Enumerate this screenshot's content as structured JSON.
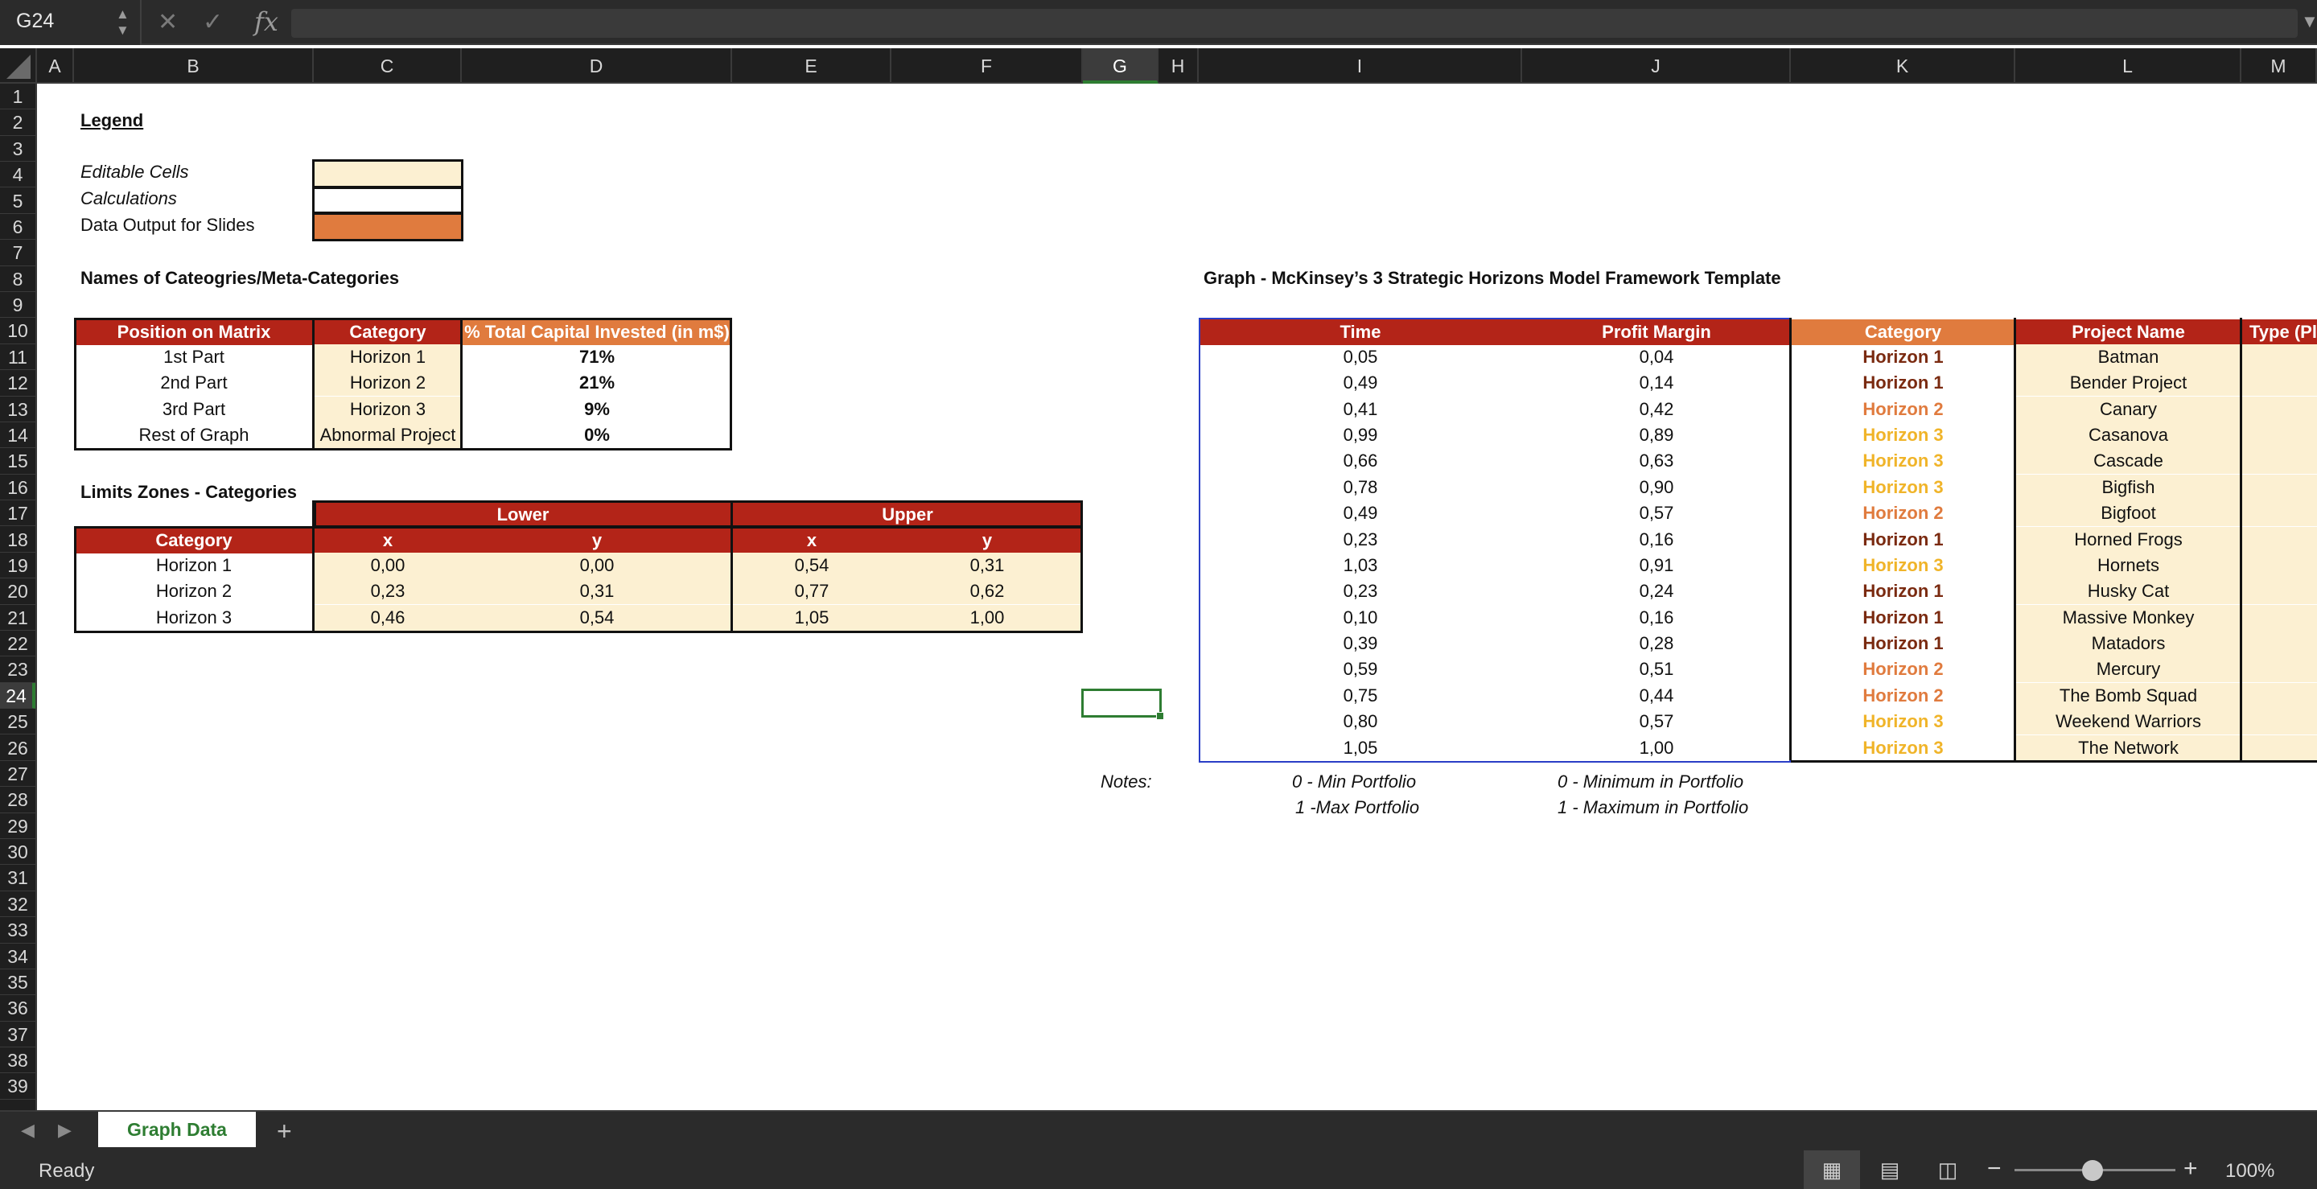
{
  "namebox": {
    "value": "G24"
  },
  "formula": {
    "fx": "fx",
    "content": ""
  },
  "columns": [
    "A",
    "B",
    "C",
    "D",
    "E",
    "F",
    "G",
    "H",
    "I",
    "J",
    "K",
    "L",
    "M"
  ],
  "rows": [
    "1",
    "2",
    "3",
    "4",
    "5",
    "6",
    "7",
    "8",
    "9",
    "10",
    "11",
    "12",
    "13",
    "14",
    "15",
    "16",
    "17",
    "18",
    "19",
    "20",
    "21",
    "22",
    "23",
    "24",
    "25",
    "26",
    "27",
    "28",
    "29",
    "30",
    "31",
    "32",
    "33",
    "34",
    "35",
    "36",
    "37",
    "38",
    "39"
  ],
  "legend": {
    "title": "Legend",
    "editable": "Editable Cells",
    "calculations": "Calculations",
    "output": "Data Output for Slides"
  },
  "names_section": {
    "title": "Names of Cateogries/Meta-Categories",
    "headers": [
      "Position on Matrix",
      "Category",
      "% Total Capital Invested (in m$)"
    ],
    "rows": [
      [
        "1st Part",
        "Horizon 1",
        "71%"
      ],
      [
        "2nd Part",
        "Horizon 2",
        "21%"
      ],
      [
        "3rd Part",
        "Horizon 3",
        "9%"
      ],
      [
        "Rest of Graph",
        "Abnormal Project",
        "0%"
      ]
    ]
  },
  "limits_section": {
    "title": "Limits Zones - Categories",
    "lower": "Lower",
    "upper": "Upper",
    "headers": [
      "Category",
      "x",
      "y",
      "x",
      "y"
    ],
    "rows": [
      [
        "Horizon 1",
        "0,00",
        "0,00",
        "0,54",
        "0,31"
      ],
      [
        "Horizon 2",
        "0,23",
        "0,31",
        "0,77",
        "0,62"
      ],
      [
        "Horizon 3",
        "0,46",
        "0,54",
        "1,05",
        "1,00"
      ]
    ]
  },
  "graph_section": {
    "title": "Graph - McKinsey’s 3 Strategic Horizons Model Framework Template",
    "headers": [
      "Time",
      "Profit Margin",
      "Category",
      "Project Name",
      "Type (Pl"
    ],
    "rows": [
      [
        "0,05",
        "0,04",
        "Horizon 1",
        "Batman"
      ],
      [
        "0,49",
        "0,14",
        "Horizon 1",
        "Bender Project"
      ],
      [
        "0,41",
        "0,42",
        "Horizon 2",
        "Canary"
      ],
      [
        "0,99",
        "0,89",
        "Horizon 3",
        "Casanova"
      ],
      [
        "0,66",
        "0,63",
        "Horizon 3",
        "Cascade"
      ],
      [
        "0,78",
        "0,90",
        "Horizon 3",
        "Bigfish"
      ],
      [
        "0,49",
        "0,57",
        "Horizon 2",
        "Bigfoot"
      ],
      [
        "0,23",
        "0,16",
        "Horizon 1",
        "Horned Frogs"
      ],
      [
        "1,03",
        "0,91",
        "Horizon 3",
        "Hornets"
      ],
      [
        "0,23",
        "0,24",
        "Horizon 1",
        "Husky Cat"
      ],
      [
        "0,10",
        "0,16",
        "Horizon 1",
        "Massive Monkey"
      ],
      [
        "0,39",
        "0,28",
        "Horizon 1",
        "Matadors"
      ],
      [
        "0,59",
        "0,51",
        "Horizon 2",
        "Mercury"
      ],
      [
        "0,75",
        "0,44",
        "Horizon 2",
        "The Bomb Squad"
      ],
      [
        "0,80",
        "0,57",
        "Horizon 3",
        "Weekend Warriors"
      ],
      [
        "1,05",
        "1,00",
        "Horizon 3",
        "The Network"
      ]
    ],
    "notes_label": "Notes:",
    "notes": [
      [
        "0 - Min Portfolio",
        "0 - Minimum in Portfolio"
      ],
      [
        "1 -Max Portfolio",
        "1 - Maximum in Portfolio"
      ]
    ]
  },
  "sheet_tabs": {
    "active": "Graph Data",
    "add": "+"
  },
  "status": {
    "text": "Ready",
    "zoom": "100%"
  },
  "colors": {
    "header_red": "#b32418",
    "header_orange": "#e07b3e",
    "editable": "#fcf0d2",
    "horizon1": "#7a2a10",
    "horizon2": "#e07b3e",
    "horizon3": "#f0b429",
    "accent_green": "#2e7d32"
  }
}
